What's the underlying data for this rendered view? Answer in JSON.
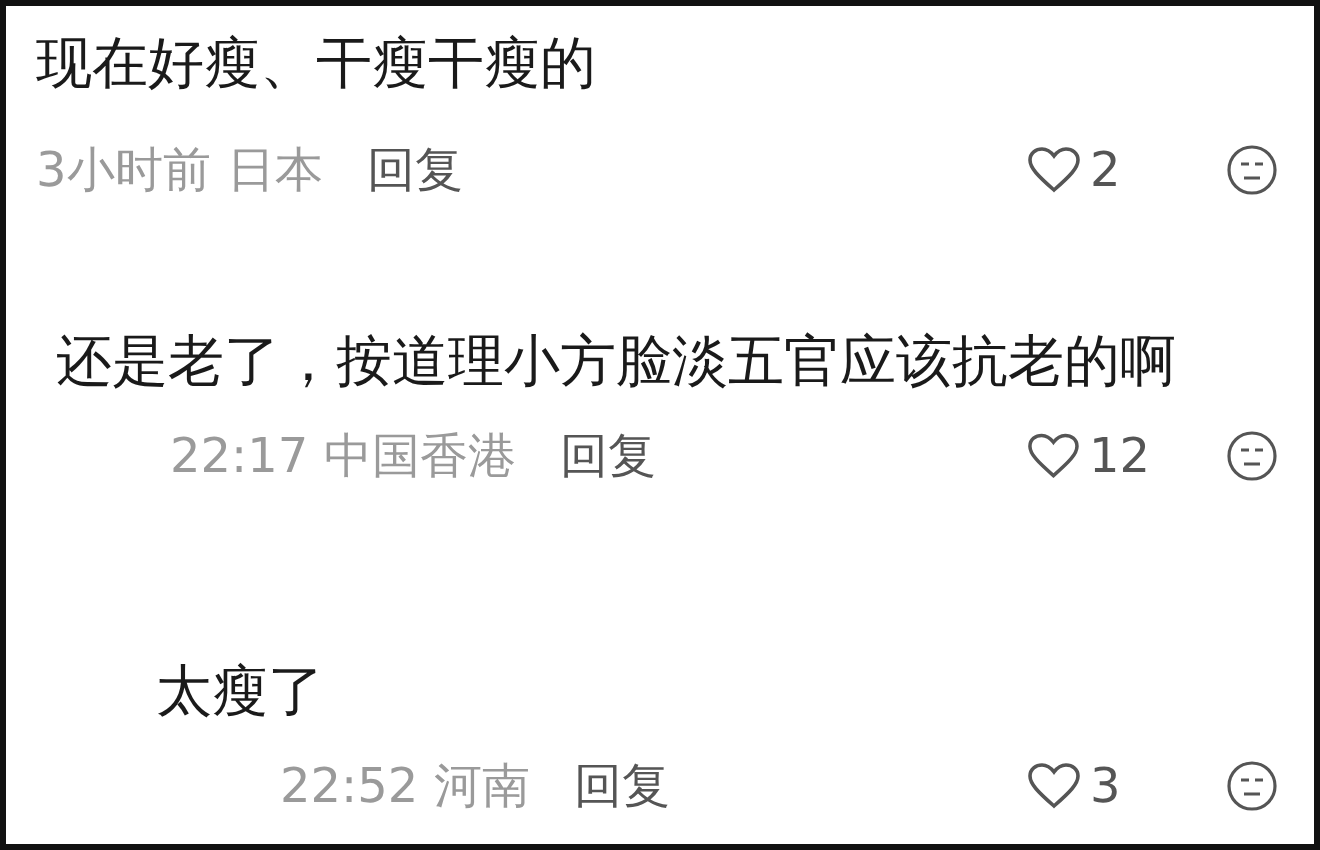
{
  "comments": [
    {
      "text": "现在好瘦、干瘦干瘦的",
      "time": "3小时前",
      "location": "日本",
      "reply": "回复",
      "likes": "2"
    },
    {
      "text": "还是老了，按道理小方脸淡五官应该抗老的啊",
      "time": "22:17",
      "location": "中国香港",
      "reply": "回复",
      "likes": "12"
    },
    {
      "text": "太瘦了",
      "time": "22:52",
      "location": "河南",
      "reply": "回复",
      "likes": "3"
    }
  ]
}
